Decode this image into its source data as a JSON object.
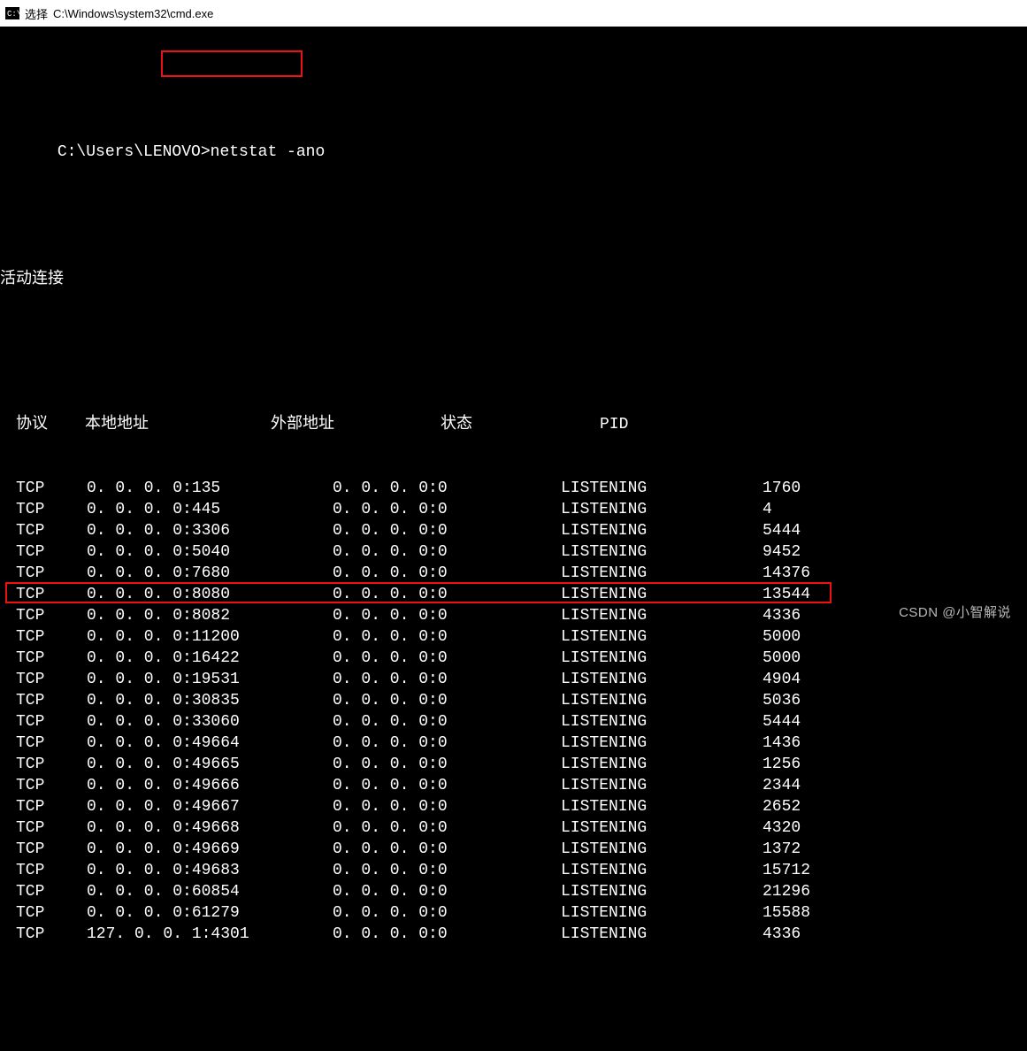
{
  "titlebar": {
    "prefix": "选择",
    "path": "C:\\Windows\\system32\\cmd.exe"
  },
  "prompt": {
    "path": "C:\\Users\\LENOVO>",
    "command": "netstat -ano"
  },
  "section_title": "活动连接",
  "headers": {
    "proto": "协议",
    "local": "本地地址",
    "foreign": "外部地址",
    "state": "状态",
    "pid": "PID"
  },
  "rows": [
    {
      "proto": "TCP",
      "local": "0.0.0.0:135",
      "foreign": "0.0.0.0:0",
      "state": "LISTENING",
      "pid": "1760",
      "highlight": false
    },
    {
      "proto": "TCP",
      "local": "0.0.0.0:445",
      "foreign": "0.0.0.0:0",
      "state": "LISTENING",
      "pid": "4",
      "highlight": false
    },
    {
      "proto": "TCP",
      "local": "0.0.0.0:3306",
      "foreign": "0.0.0.0:0",
      "state": "LISTENING",
      "pid": "5444",
      "highlight": false
    },
    {
      "proto": "TCP",
      "local": "0.0.0.0:5040",
      "foreign": "0.0.0.0:0",
      "state": "LISTENING",
      "pid": "9452",
      "highlight": false
    },
    {
      "proto": "TCP",
      "local": "0.0.0.0:7680",
      "foreign": "0.0.0.0:0",
      "state": "LISTENING",
      "pid": "14376",
      "highlight": false
    },
    {
      "proto": "TCP",
      "local": "0.0.0.0:8080",
      "foreign": "0.0.0.0:0",
      "state": "LISTENING",
      "pid": "13544",
      "highlight": true
    },
    {
      "proto": "TCP",
      "local": "0.0.0.0:8082",
      "foreign": "0.0.0.0:0",
      "state": "LISTENING",
      "pid": "4336",
      "highlight": false
    },
    {
      "proto": "TCP",
      "local": "0.0.0.0:11200",
      "foreign": "0.0.0.0:0",
      "state": "LISTENING",
      "pid": "5000",
      "highlight": false
    },
    {
      "proto": "TCP",
      "local": "0.0.0.0:16422",
      "foreign": "0.0.0.0:0",
      "state": "LISTENING",
      "pid": "5000",
      "highlight": false
    },
    {
      "proto": "TCP",
      "local": "0.0.0.0:19531",
      "foreign": "0.0.0.0:0",
      "state": "LISTENING",
      "pid": "4904",
      "highlight": false
    },
    {
      "proto": "TCP",
      "local": "0.0.0.0:30835",
      "foreign": "0.0.0.0:0",
      "state": "LISTENING",
      "pid": "5036",
      "highlight": false
    },
    {
      "proto": "TCP",
      "local": "0.0.0.0:33060",
      "foreign": "0.0.0.0:0",
      "state": "LISTENING",
      "pid": "5444",
      "highlight": false
    },
    {
      "proto": "TCP",
      "local": "0.0.0.0:49664",
      "foreign": "0.0.0.0:0",
      "state": "LISTENING",
      "pid": "1436",
      "highlight": false
    },
    {
      "proto": "TCP",
      "local": "0.0.0.0:49665",
      "foreign": "0.0.0.0:0",
      "state": "LISTENING",
      "pid": "1256",
      "highlight": false
    },
    {
      "proto": "TCP",
      "local": "0.0.0.0:49666",
      "foreign": "0.0.0.0:0",
      "state": "LISTENING",
      "pid": "2344",
      "highlight": false
    },
    {
      "proto": "TCP",
      "local": "0.0.0.0:49667",
      "foreign": "0.0.0.0:0",
      "state": "LISTENING",
      "pid": "2652",
      "highlight": false
    },
    {
      "proto": "TCP",
      "local": "0.0.0.0:49668",
      "foreign": "0.0.0.0:0",
      "state": "LISTENING",
      "pid": "4320",
      "highlight": false
    },
    {
      "proto": "TCP",
      "local": "0.0.0.0:49669",
      "foreign": "0.0.0.0:0",
      "state": "LISTENING",
      "pid": "1372",
      "highlight": false
    },
    {
      "proto": "TCP",
      "local": "0.0.0.0:49683",
      "foreign": "0.0.0.0:0",
      "state": "LISTENING",
      "pid": "15712",
      "highlight": false
    },
    {
      "proto": "TCP",
      "local": "0.0.0.0:60854",
      "foreign": "0.0.0.0:0",
      "state": "LISTENING",
      "pid": "21296",
      "highlight": false
    },
    {
      "proto": "TCP",
      "local": "0.0.0.0:61279",
      "foreign": "0.0.0.0:0",
      "state": "LISTENING",
      "pid": "15588",
      "highlight": false
    },
    {
      "proto": "TCP",
      "local": "127.0.0.1:4301",
      "foreign": "0.0.0.0:0",
      "state": "LISTENING",
      "pid": "4336",
      "highlight": false
    }
  ],
  "watermark": "CSDN @小智解说",
  "colors": {
    "highlight_border": "#e11"
  }
}
